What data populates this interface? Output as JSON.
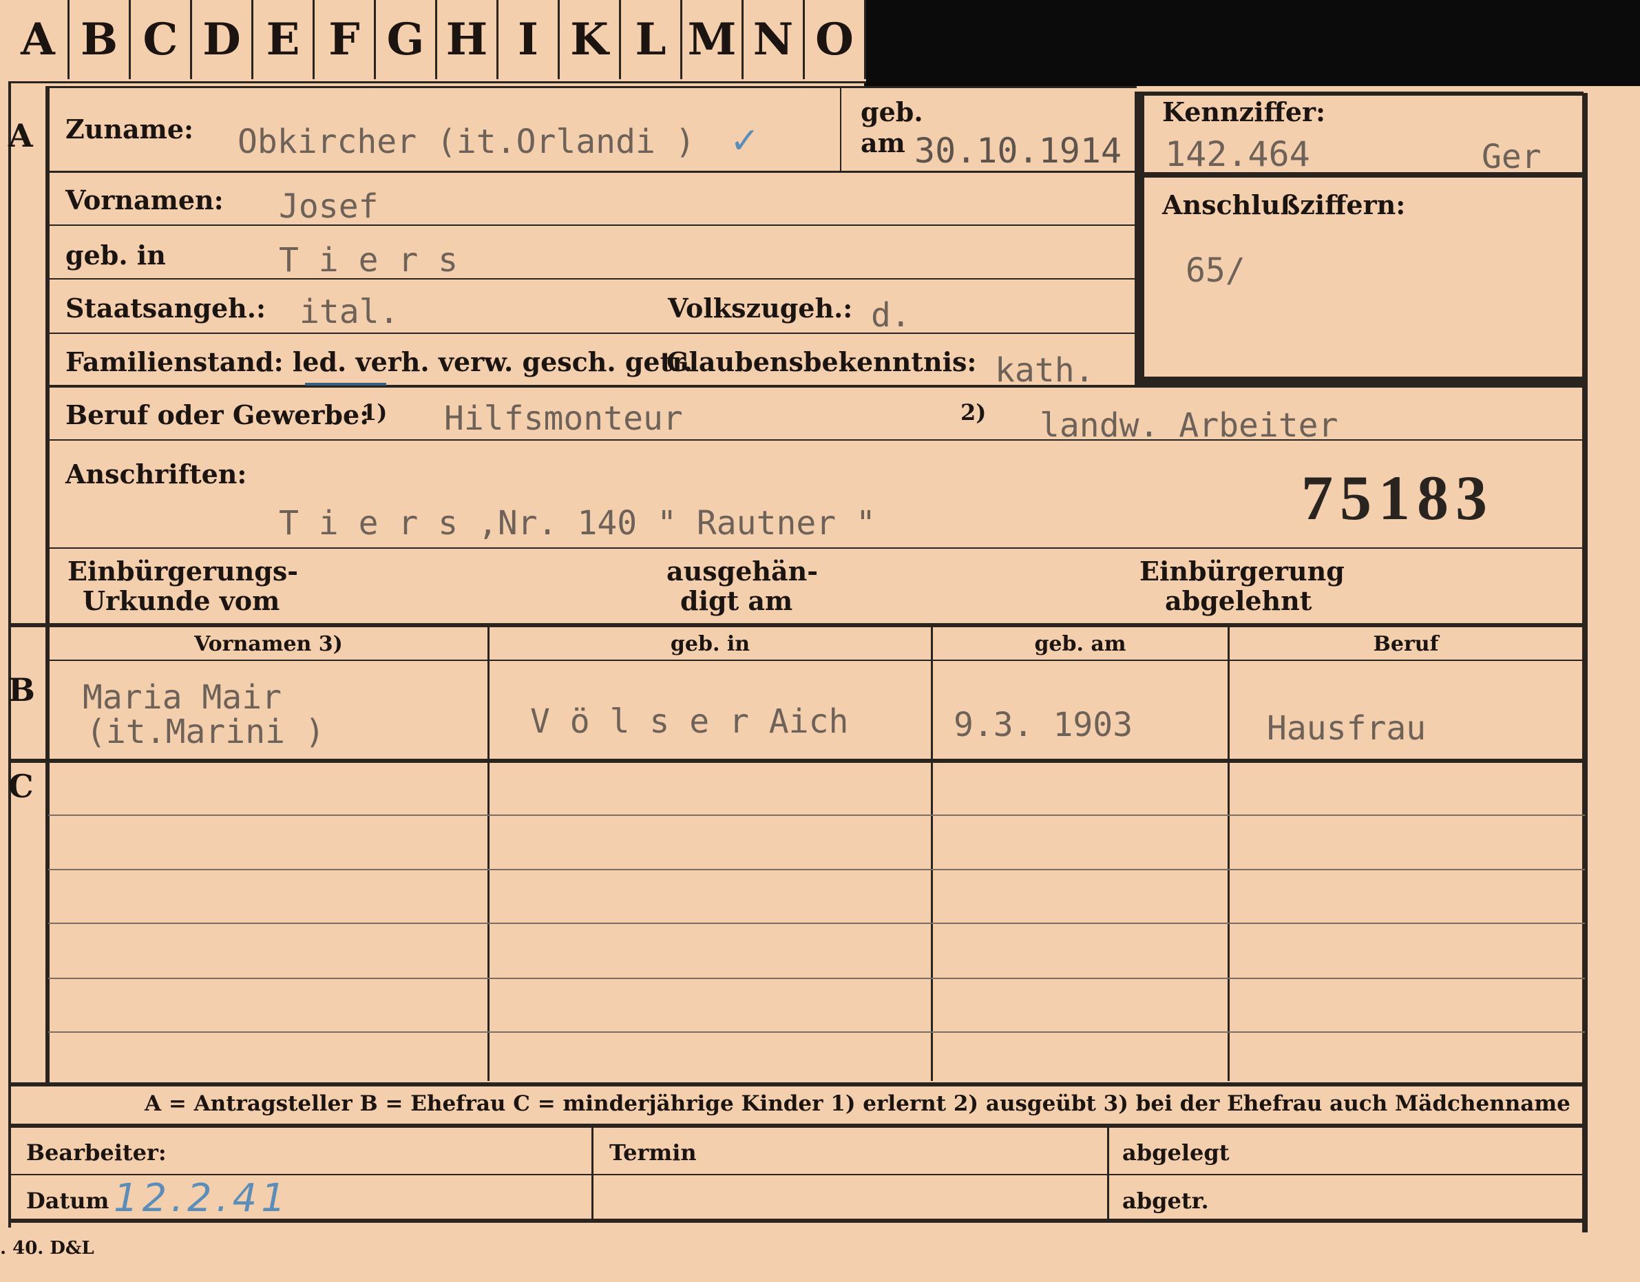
{
  "tabs": [
    "A",
    "B",
    "C",
    "D",
    "E",
    "F",
    "G",
    "H",
    "I",
    "K",
    "L",
    "M",
    "N",
    "O"
  ],
  "row_letters": {
    "a": "A",
    "b": "B",
    "c": "C"
  },
  "labels": {
    "zuname": "Zuname:",
    "geb_line1": "geb.",
    "geb_line2": "am",
    "kennziffer": "Kennziffer:",
    "vornamen": "Vornamen:",
    "geb_in": "geb. in",
    "anschlussziffern": "Anschlußziffern:",
    "staatsangeh": "Staatsangeh.:",
    "volkszugeh": "Volkszugeh.:",
    "familienstand": "Familienstand: led. verh. verw. gesch. getr.",
    "glaubensbekenntnis": "Glaubensbekenntnis:",
    "beruf_oder_gewerbe": "Beruf oder Gewerbe:",
    "fn1": "1)",
    "fn2": "2)",
    "anschriften": "Anschriften:",
    "einbuergerung_urkunde_1": "Einbürgerungs-",
    "einbuergerung_urkunde_2": "Urkunde vom",
    "ausgehaendigt_1": "ausgehän-",
    "ausgehaendigt_2": "digt am",
    "einbuergerung_abgelehnt_1": "Einbürgerung",
    "einbuergerung_abgelehnt_2": "abgelehnt"
  },
  "values": {
    "zuname": "Obkircher (it.Orlandi )",
    "check_mark": "✓",
    "geb_am": "30.10.1914",
    "kennziffer": "142.464",
    "kennziffer_suffix": "Ger",
    "vornamen": "Josef",
    "geb_in": "T i e r s",
    "anschlussziffern": "65/",
    "staatsangeh": "ital.",
    "volkszugeh": "d.",
    "glaubensbekenntnis": "kath.",
    "beruf_erlernt": "Hilfsmonteur",
    "beruf_ausgeuebt": "landw. Arbeiter",
    "anschrift": "T i e r s ,Nr. 140 \" Rautner \"",
    "card_number": "75183"
  },
  "family_table": {
    "headers": [
      "Vornamen 3)",
      "geb. in",
      "geb. am",
      "Beruf"
    ],
    "spouse": {
      "vornamen_line1": "Maria  Mair",
      "vornamen_line2": "(it.Marini )",
      "geb_in": "V ö l s e r  Aich",
      "geb_am": "9.3. 1903",
      "beruf": "Hausfrau"
    }
  },
  "legend": "A = Antragsteller   B = Ehefrau   C = minderjährige Kinder   1) erlernt   2) ausgeübt   3) bei der Ehefrau auch Mädchenname",
  "footer": {
    "bearbeiter": "Bearbeiter:",
    "termin": "Termin",
    "abgelegt": "abgelegt",
    "datum": "Datum",
    "datum_value": "12.2.41",
    "abgetr": "abgetr."
  },
  "print_mark": ". 40. D&L"
}
